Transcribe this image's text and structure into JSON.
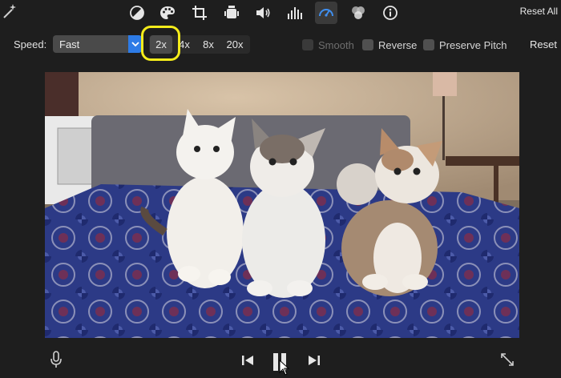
{
  "toolbar": {
    "tools": [
      {
        "name": "color-balance-icon",
        "active": false
      },
      {
        "name": "color-correction-icon",
        "active": false
      },
      {
        "name": "crop-icon",
        "active": false
      },
      {
        "name": "stabilization-icon",
        "active": false
      },
      {
        "name": "volume-icon",
        "active": false
      },
      {
        "name": "equalizer-icon",
        "active": false
      },
      {
        "name": "speed-icon",
        "active": true
      },
      {
        "name": "clip-filter-icon",
        "active": false
      },
      {
        "name": "info-icon",
        "active": false
      }
    ],
    "reset_all_label": "Reset All"
  },
  "speed": {
    "label": "Speed:",
    "selected": "Fast",
    "multipliers": [
      "2x",
      "4x",
      "8x",
      "20x"
    ],
    "selected_multiplier": "2x",
    "smooth_label": "Smooth",
    "reverse_label": "Reverse",
    "preserve_pitch_label": "Preserve Pitch",
    "reset_label": "Reset"
  },
  "colors": {
    "accent": "#2d7be6",
    "highlight": "#f4ec1b"
  }
}
